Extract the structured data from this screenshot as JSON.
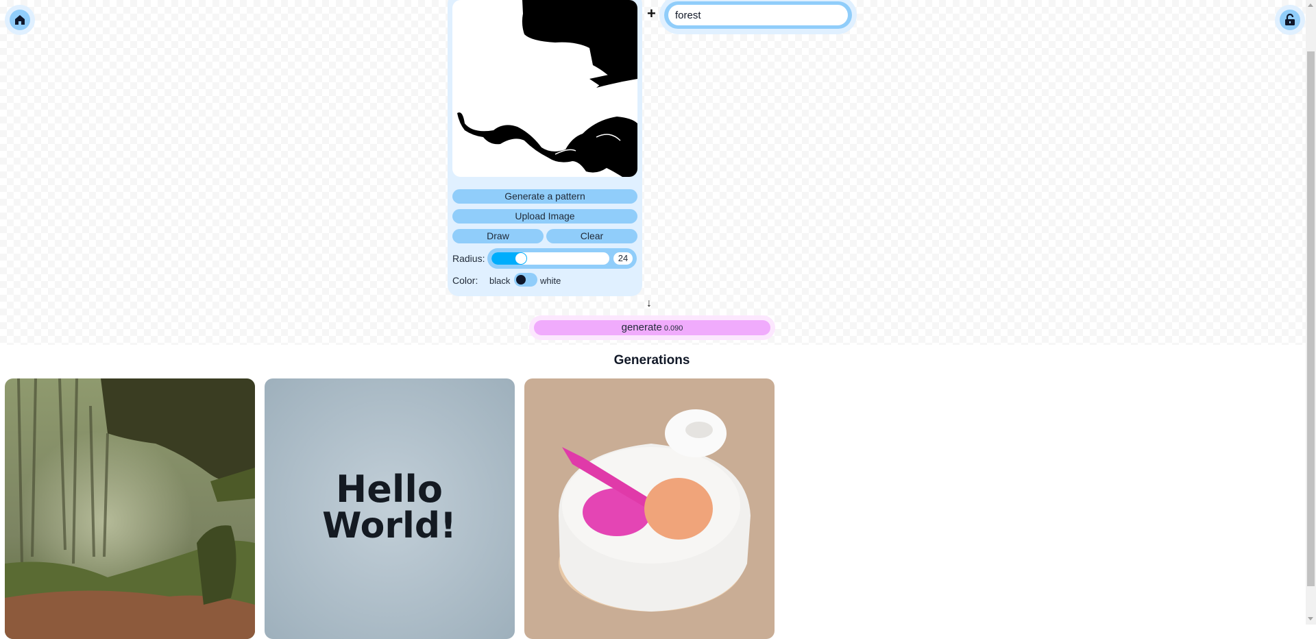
{
  "nav": {
    "home_icon": "home-icon",
    "lock_icon": "unlock-icon"
  },
  "mask_panel": {
    "generate_pattern_label": "Generate a pattern",
    "upload_label": "Upload Image",
    "draw_label": "Draw",
    "clear_label": "Clear",
    "radius_label": "Radius:",
    "radius_value": "24",
    "radius_fraction": 0.22,
    "color_label": "Color:",
    "color_left": "black",
    "color_right": "white",
    "color_selected": "black"
  },
  "prompt": {
    "add_icon": "+",
    "value": "forest"
  },
  "flow_arrow": "↓",
  "generate": {
    "label": "generate",
    "cost": "0.090"
  },
  "generations": {
    "title": "Generations",
    "items": [
      {
        "name": "forest"
      },
      {
        "name": "hello-world"
      },
      {
        "name": "cake"
      }
    ]
  },
  "colors": {
    "panel_bg": "#e0f0ff",
    "button_blue": "#90cdfa",
    "slider_fill": "#00adfc",
    "generate_pink": "#f0abfc"
  }
}
